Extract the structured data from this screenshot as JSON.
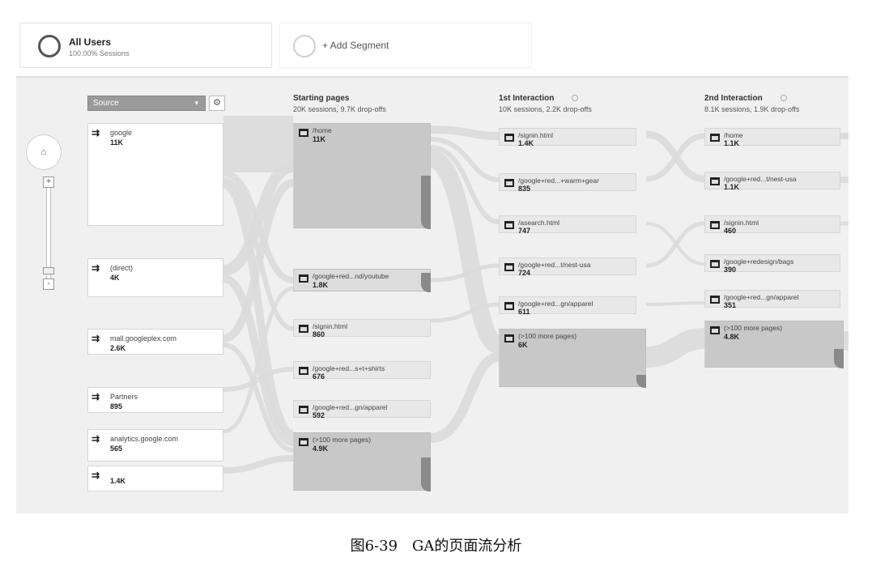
{
  "segments": {
    "all_users": {
      "title": "All Users",
      "subtitle": "100.00% Sessions"
    },
    "add": {
      "label": "+ Add Segment"
    }
  },
  "controls": {
    "dimension": "Source",
    "gear_icon": "gear-icon",
    "home_icon": "⌂",
    "zoom_in": "+",
    "zoom_out": "-"
  },
  "columns": [
    {
      "title": "Starting pages",
      "subtitle": "20K sessions, 9.7K drop-offs"
    },
    {
      "title": "1st Interaction",
      "subtitle": "10K sessions, 2.2K drop-offs"
    },
    {
      "title": "2nd Interaction",
      "subtitle": "8.1K sessions, 1.9K drop-offs"
    }
  ],
  "sources": [
    {
      "label": "google",
      "value": "11K"
    },
    {
      "label": "(direct)",
      "value": "4K"
    },
    {
      "label": "mall.googleplex.com",
      "value": "2.6K"
    },
    {
      "label": "Partners",
      "value": "895"
    },
    {
      "label": "analytics.google.com",
      "value": "565"
    },
    {
      "label": "",
      "value": "1.4K"
    }
  ],
  "starting_pages": [
    {
      "label": "/home",
      "value": "11K"
    },
    {
      "label": "/google+red...nd/youtube",
      "value": "1.8K"
    },
    {
      "label": "/signin.html",
      "value": "860"
    },
    {
      "label": "/google+red...s+t+shirts",
      "value": "676"
    },
    {
      "label": "/google+red...gn/apparel",
      "value": "592"
    },
    {
      "label": "(>100 more pages)",
      "value": "4.9K"
    }
  ],
  "first_interaction": [
    {
      "label": "/signin.html",
      "value": "1.4K"
    },
    {
      "label": "/google+red...+warm+gear",
      "value": "835"
    },
    {
      "label": "/asearch.html",
      "value": "747"
    },
    {
      "label": "/google+red...t/nest-usa",
      "value": "724"
    },
    {
      "label": "/google+red...gn/apparel",
      "value": "611"
    },
    {
      "label": "(>100 more pages)",
      "value": "6K"
    }
  ],
  "second_interaction": [
    {
      "label": "/home",
      "value": "1.1K"
    },
    {
      "label": "/google+red...t/nest-usa",
      "value": "1.1K"
    },
    {
      "label": "/signin.html",
      "value": "460"
    },
    {
      "label": "/google+redesign/bags",
      "value": "390"
    },
    {
      "label": "/google+red...gn/apparel",
      "value": "351"
    },
    {
      "label": "(>100 more pages)",
      "value": "4.8K"
    }
  ],
  "caption": "图6-39　GA的页面流分析"
}
